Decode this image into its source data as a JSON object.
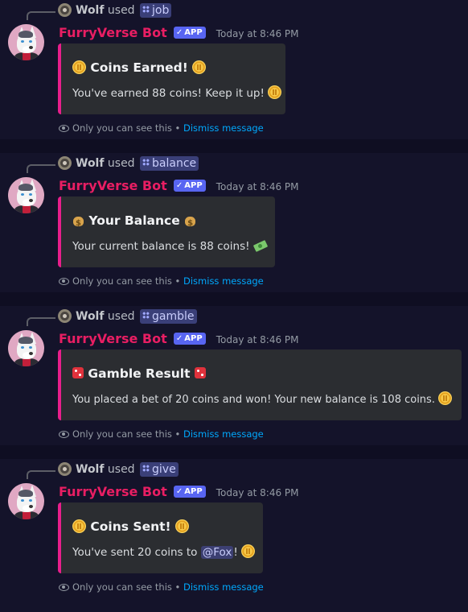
{
  "colors": {
    "bot_name": "#e91e63",
    "embed_border": "#e91e8c",
    "app_badge": "#5865f2",
    "link": "#00a8fc"
  },
  "messages": [
    {
      "reply_user": "Wolf",
      "reply_verb": "used",
      "command": "job",
      "bot_name": "FurryVerse Bot",
      "badge": "APP",
      "timestamp": "Today at 8:46 PM",
      "embed_title": "Coins Earned!",
      "embed_desc": "You've earned 88 coins! Keep it up!",
      "title_icon": "coin-icon",
      "desc_icon": "coin-icon",
      "footer_text": "Only you can see this",
      "footer_sep": "•",
      "dismiss": "Dismiss message"
    },
    {
      "reply_user": "Wolf",
      "reply_verb": "used",
      "command": "balance",
      "bot_name": "FurryVerse Bot",
      "badge": "APP",
      "timestamp": "Today at 8:46 PM",
      "embed_title": "Your Balance",
      "embed_desc": "Your current balance is 88 coins!",
      "title_icon": "money-bag-icon",
      "desc_icon": "cash-icon",
      "footer_text": "Only you can see this",
      "footer_sep": "•",
      "dismiss": "Dismiss message"
    },
    {
      "reply_user": "Wolf",
      "reply_verb": "used",
      "command": "gamble",
      "bot_name": "FurryVerse Bot",
      "badge": "APP",
      "timestamp": "Today at 8:46 PM",
      "embed_title": "Gamble Result",
      "embed_desc": "You placed a bet of 20 coins and won! Your new balance is 108 coins.",
      "title_icon": "dice-icon",
      "desc_icon": "coin-icon",
      "footer_text": "Only you can see this",
      "footer_sep": "•",
      "dismiss": "Dismiss message"
    },
    {
      "reply_user": "Wolf",
      "reply_verb": "used",
      "command": "give",
      "bot_name": "FurryVerse Bot",
      "badge": "APP",
      "timestamp": "Today at 8:46 PM",
      "embed_title": "Coins Sent!",
      "embed_desc_pre": "You've sent 20 coins to",
      "embed_mention": "@Fox",
      "embed_desc_post": "!",
      "title_icon": "coin-icon",
      "desc_icon": "coin-icon",
      "footer_text": "Only you can see this",
      "footer_sep": "•",
      "dismiss": "Dismiss message"
    }
  ]
}
